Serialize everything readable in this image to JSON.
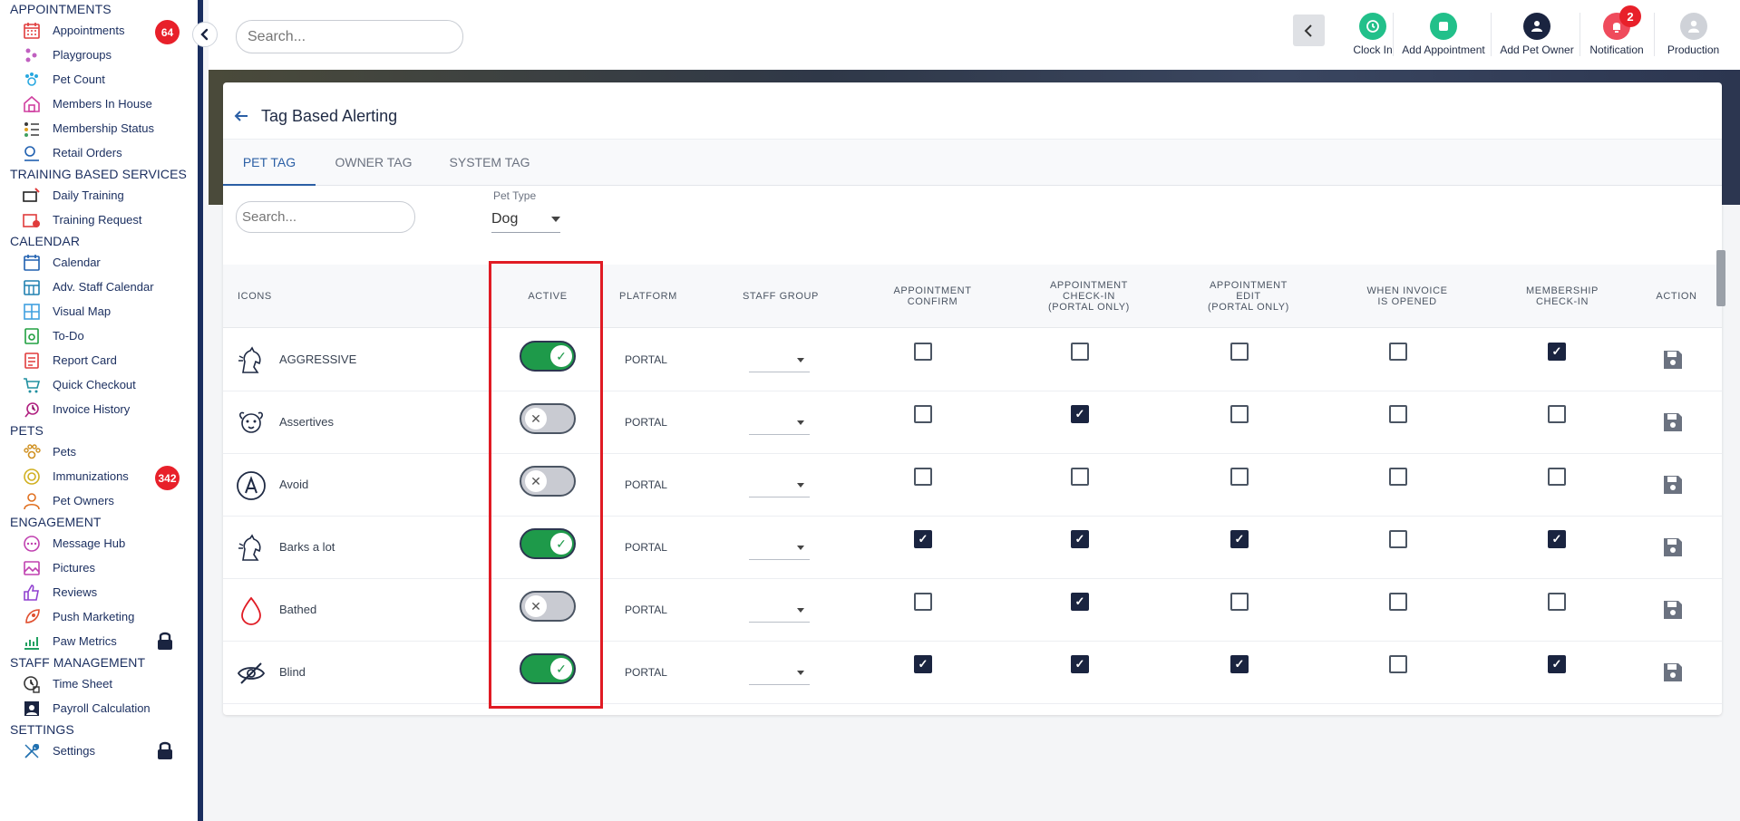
{
  "sidebar": {
    "sections": [
      {
        "title": "APPOINTMENTS",
        "items": [
          {
            "label": "Appointments",
            "icon": "calendar-grid-icon",
            "badge": "64"
          },
          {
            "label": "Playgroups",
            "icon": "paws-group-icon"
          },
          {
            "label": "Pet Count",
            "icon": "paw-count-icon"
          },
          {
            "label": "Members In House",
            "icon": "house-icon"
          },
          {
            "label": "Membership Status",
            "icon": "member-list-icon"
          },
          {
            "label": "Retail Orders",
            "icon": "retail-orders-icon"
          }
        ]
      },
      {
        "title": "TRAINING BASED SERVICES",
        "items": [
          {
            "label": "Daily Training",
            "icon": "daily-training-icon"
          },
          {
            "label": "Training Request",
            "icon": "training-request-icon"
          }
        ]
      },
      {
        "title": "CALENDAR",
        "items": [
          {
            "label": "Calendar",
            "icon": "calendar-icon"
          },
          {
            "label": "Adv. Staff Calendar",
            "icon": "staff-calendar-icon"
          },
          {
            "label": "Visual Map",
            "icon": "visual-map-icon"
          },
          {
            "label": "To-Do",
            "icon": "todo-icon"
          },
          {
            "label": "Report Card",
            "icon": "report-card-icon"
          },
          {
            "label": "Quick Checkout",
            "icon": "cart-icon"
          },
          {
            "label": "Invoice History",
            "icon": "invoice-history-icon"
          }
        ]
      },
      {
        "title": "PETS",
        "items": [
          {
            "label": "Pets",
            "icon": "paw-icon"
          },
          {
            "label": "Immunizations",
            "icon": "shield-icon",
            "badge": "342"
          },
          {
            "label": "Pet Owners",
            "icon": "person-icon"
          }
        ]
      },
      {
        "title": "ENGAGEMENT",
        "items": [
          {
            "label": "Message Hub",
            "icon": "chat-icon"
          },
          {
            "label": "Pictures",
            "icon": "image-icon"
          },
          {
            "label": "Reviews",
            "icon": "thumbs-up-icon"
          },
          {
            "label": "Push Marketing",
            "icon": "rocket-icon"
          },
          {
            "label": "Paw Metrics",
            "icon": "chart-icon",
            "locked": true
          }
        ]
      },
      {
        "title": "STAFF MANAGEMENT",
        "items": [
          {
            "label": "Time Sheet",
            "icon": "clock-icon"
          },
          {
            "label": "Payroll Calculation",
            "icon": "payroll-icon"
          }
        ]
      },
      {
        "title": "SETTINGS",
        "items": [
          {
            "label": "Settings",
            "icon": "wrench-icon",
            "locked": true
          }
        ]
      }
    ]
  },
  "topbar": {
    "search_placeholder": "Search...",
    "actions": [
      {
        "label": "Clock In",
        "icon": "clock-in-icon",
        "color": "#22c08a"
      },
      {
        "label": "Add Appointment",
        "icon": "add-appointment-icon",
        "color": "#22c08a"
      },
      {
        "label": "Add Pet Owner",
        "icon": "add-person-icon",
        "color": "#1a2440"
      },
      {
        "label": "Notification",
        "icon": "bell-icon",
        "color": "#ef4b5c",
        "badge": "2"
      },
      {
        "label": "Production",
        "icon": "profile-icon",
        "color": "#cfd2d8"
      }
    ]
  },
  "page": {
    "title": "Tag Based Alerting",
    "tabs": [
      {
        "label": "PET TAG",
        "active": true
      },
      {
        "label": "OWNER TAG",
        "active": false
      },
      {
        "label": "SYSTEM TAG",
        "active": false
      }
    ],
    "search_placeholder": "Search...",
    "pet_type_label": "Pet Type",
    "pet_type_value": "Dog"
  },
  "table": {
    "headers": {
      "icons": "ICONS",
      "active": "ACTIVE",
      "platform": "PLATFORM",
      "staff_group": "STAFF GROUP",
      "appt_confirm": "APPOINTMENT\nCONFIRM",
      "appt_checkin": "APPOINTMENT\nCHECK-IN\n(PORTAL ONLY)",
      "appt_edit": "APPOINTMENT\nEDIT\n(PORTAL ONLY)",
      "invoice_opened": "WHEN INVOICE\nIS OPENED",
      "membership_checkin": "MEMBERSHIP\nCHECK-IN",
      "action": "ACTION"
    },
    "rows": [
      {
        "name": "AGGRESSIVE",
        "icon": "horse-head-icon",
        "active": true,
        "platform": "PORTAL",
        "checks": [
          false,
          false,
          false,
          false,
          true
        ]
      },
      {
        "name": "Assertives",
        "icon": "dog-face-icon",
        "active": false,
        "platform": "PORTAL",
        "checks": [
          false,
          true,
          false,
          false,
          false
        ]
      },
      {
        "name": "Avoid",
        "icon": "letter-a-circle-icon",
        "active": false,
        "platform": "PORTAL",
        "checks": [
          false,
          false,
          false,
          false,
          false
        ]
      },
      {
        "name": "Barks a lot",
        "icon": "horse-head-icon",
        "active": true,
        "platform": "PORTAL",
        "checks": [
          true,
          true,
          true,
          false,
          true
        ]
      },
      {
        "name": "Bathed",
        "icon": "water-drop-icon",
        "active": false,
        "platform": "PORTAL",
        "checks": [
          false,
          true,
          false,
          false,
          false
        ]
      },
      {
        "name": "Blind",
        "icon": "eye-slash-icon",
        "active": true,
        "platform": "PORTAL",
        "checks": [
          true,
          true,
          true,
          false,
          true
        ]
      }
    ]
  },
  "colors": {
    "sidebar_accent": "#1a2e5f",
    "toggle_on": "#1e9a4a",
    "toggle_off": "#c9cbd2",
    "checkbox_checked": "#1a2440",
    "highlight": "#e01b24",
    "badge": "#e8202a"
  }
}
